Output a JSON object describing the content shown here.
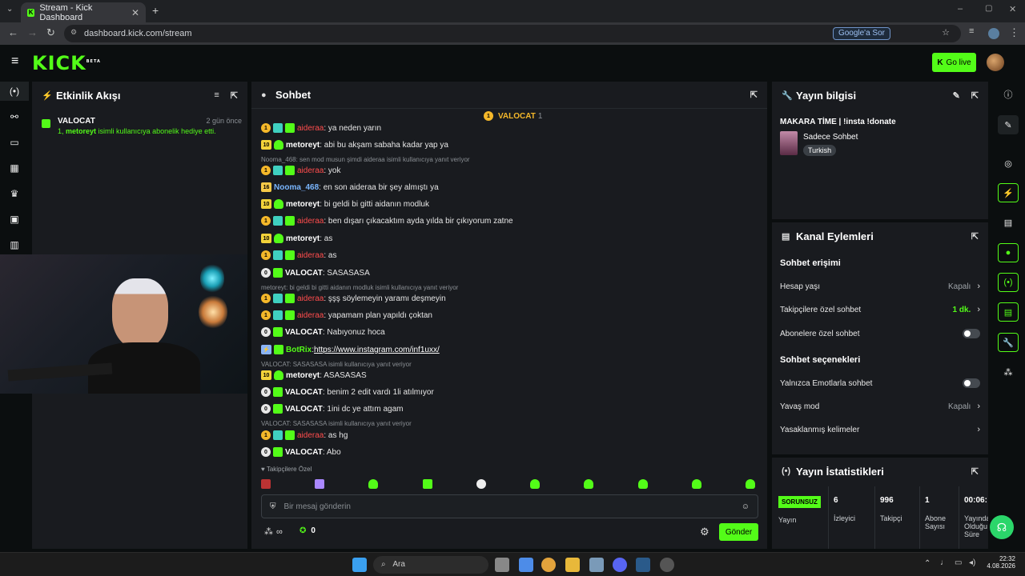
{
  "browser": {
    "tab_title": "Stream - Kick Dashboard",
    "url": "dashboard.kick.com/stream",
    "ask_google": "Google'a Sor"
  },
  "header": {
    "logo": "KICK",
    "logo_sup": "BETA",
    "go_live": "Go live"
  },
  "activity": {
    "title": "Etkinlik Akışı",
    "item_user": "VALOCAT",
    "item_time": "2 gün önce",
    "item_count": "1,",
    "item_target": "metoreyt",
    "item_text": "isimli kullanıcıya abonelik hediye etti."
  },
  "chat": {
    "title": "Sohbet",
    "pinned_user": "VALOCAT",
    "pinned_count": "1",
    "followers_only": "Takipçilere Özel",
    "input_placeholder": "Bir mesaj gönderin",
    "send_label": "Gönder",
    "points_value": "0",
    "infinity": "∞",
    "messages": [
      {
        "badge": "1",
        "user": "aideraa",
        "text": ": ya neden yarın"
      },
      {
        "badge": "10",
        "user": "metoreyt",
        "text": ": abi bu akşam sabaha kadar yap ya"
      },
      {
        "reply": "Nooma_468: sen mod musun şimdi aideraa isimli kullanıcıya yanıt veriyor"
      },
      {
        "badge": "1",
        "user": "aideraa",
        "text": ": yok"
      },
      {
        "badge": "16",
        "user": "Nooma_468",
        "text": ": en son aideraa bir şey almıştı ya"
      },
      {
        "badge": "10",
        "user": "metoreyt",
        "text": ": bi geldi bi gitti aidanın modluk"
      },
      {
        "badge": "1",
        "user": "aideraa",
        "text": ": ben dışarı çıkacaktım ayda yılda bir çıkıyorum zatne"
      },
      {
        "badge": "10",
        "user": "metoreyt",
        "text": ": as"
      },
      {
        "badge": "1",
        "user": "aideraa",
        "text": ": as"
      },
      {
        "badge": "0",
        "user": "VALOCAT",
        "text": ": SASASASA"
      },
      {
        "reply": "metoreyt: bi geldi bi gitti aidanın modluk isimli kullanıcıya yanıt veriyor"
      },
      {
        "badge": "1",
        "user": "aideraa",
        "text": ": şşş söylemeyin yaramı deşmeyin"
      },
      {
        "badge": "1",
        "user": "aideraa",
        "text": ": yapamam plan yapıldı çoktan"
      },
      {
        "badge": "0",
        "user": "VALOCAT",
        "text": ": Nabıyonuz hoca"
      },
      {
        "badge": "",
        "user": "BotRix",
        "text": ": ",
        "link": "https://www.instagram.com/inf1uxx/"
      },
      {
        "reply": "VALOCAT: SASASASA isimli kullanıcıya yanıt veriyor"
      },
      {
        "badge": "10",
        "user": "metoreyt",
        "text": ": ASASASAS"
      },
      {
        "badge": "0",
        "user": "VALOCAT",
        "text": ": benim 2 edit vardı 1li atılmıyor"
      },
      {
        "badge": "0",
        "user": "VALOCAT",
        "text": ": 1ini dc ye attım agam"
      },
      {
        "reply": "VALOCAT: SASASASA isimli kullanıcıya yanıt veriyor"
      },
      {
        "badge": "1",
        "user": "aideraa",
        "text": ": as hg"
      },
      {
        "badge": "0",
        "user": "VALOCAT",
        "text": ": Abo"
      }
    ]
  },
  "stream_info": {
    "title": "Yayın bilgisi",
    "stream_title": "MAKARA TİME | !insta !donate",
    "category": "Sadece Sohbet",
    "language_tag": "Turkish"
  },
  "channel_actions": {
    "title": "Kanal Eylemleri",
    "chat_access": "Sohbet erişimi",
    "account_age": "Hesap yaşı",
    "account_age_value": "Kapalı",
    "followers_only": "Takipçilere özel sohbet",
    "followers_only_value": "1 dk.",
    "subscribers_only": "Abonelere özel sohbet",
    "chat_options": "Sohbet seçenekleri",
    "emotes_only": "Yalnızca Emotlarla sohbet",
    "slow_mode": "Yavaş mod",
    "slow_mode_value": "Kapalı",
    "banned_words": "Yasaklanmış kelimeler"
  },
  "stream_stats": {
    "title": "Yayın İstatistikleri",
    "status_badge": "SORUNSUZ",
    "status_label": "Yayın",
    "viewers": "6",
    "viewers_label": "İzleyici",
    "followers": "996",
    "followers_label": "Takipçi",
    "subs": "1",
    "subs_label": "Abone Sayısı",
    "duration": "00:06:",
    "duration_label": "Yayında Olduğu Süre"
  },
  "taskbar": {
    "search": "Ara",
    "time": "22:32",
    "date": "4.08.2026"
  },
  "colors": {
    "accent": "#53fc18",
    "panel": "#191b1f",
    "background": "#0b0e0f",
    "username_red": "#ff4d4d",
    "username_blue": "#7ab6ff"
  }
}
